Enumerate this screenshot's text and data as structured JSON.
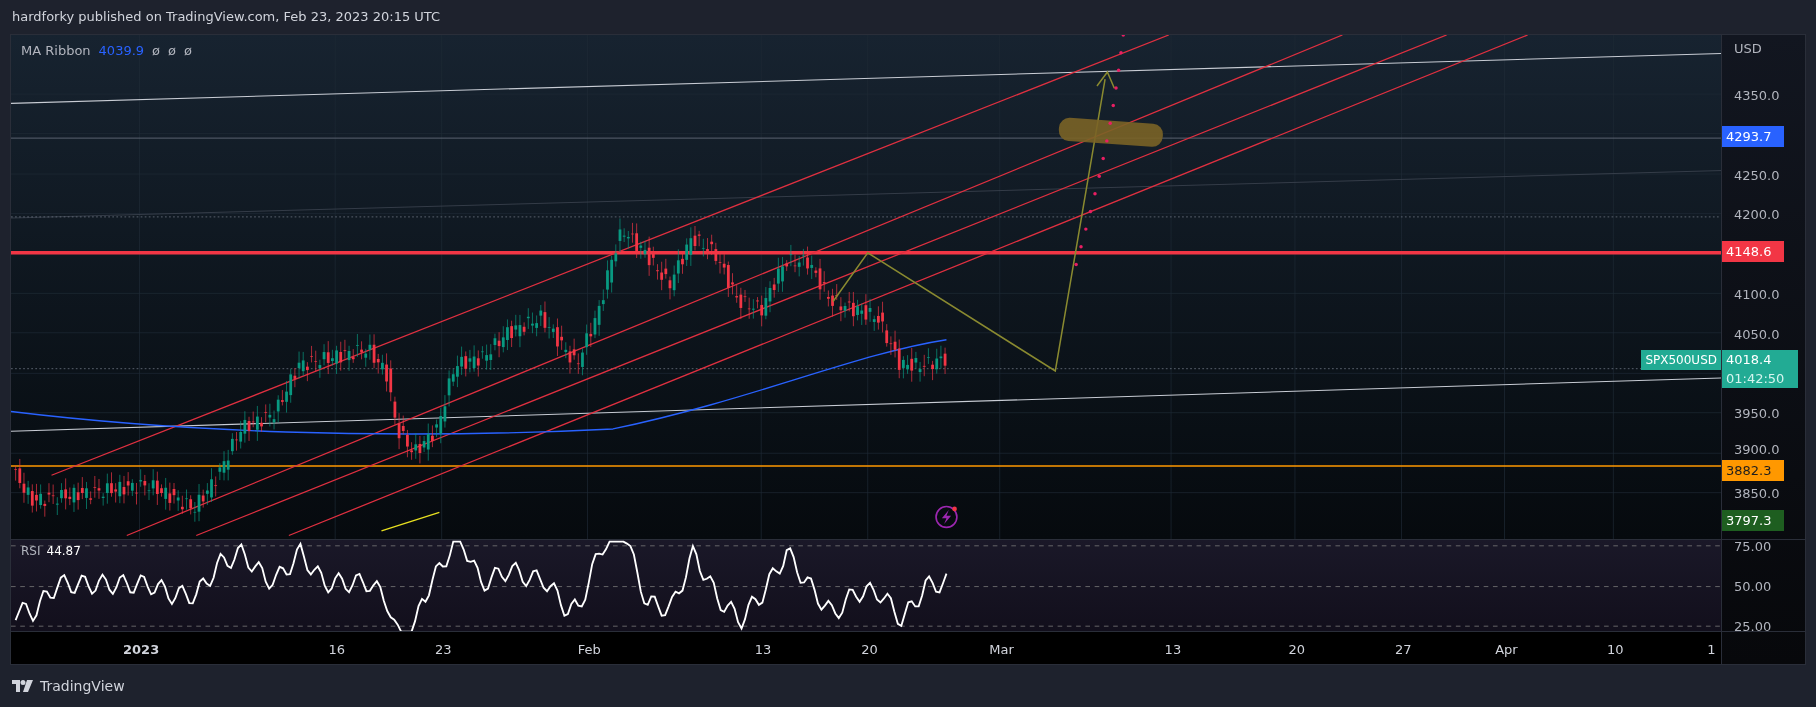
{
  "header": {
    "text": "hardforky published on TradingView.com, Feb 23, 2023 20:15 UTC"
  },
  "legend": {
    "name": "MA Ribbon",
    "value": "4039.9",
    "extras": [
      "ø",
      "ø",
      "ø"
    ]
  },
  "price_axis": {
    "currency": "USD",
    "ticks": [
      "4350.0",
      "4250.0",
      "4200.0",
      "4100.0",
      "4050.0",
      "3950.0",
      "3900.0",
      "3850.0"
    ]
  },
  "price_badges": [
    {
      "label": "4293.7",
      "color": "#2962ff"
    },
    {
      "label": "4148.6",
      "color": "#f23645"
    },
    {
      "label": "4018.4",
      "sublabel": "01:42:50",
      "symbol": "SPX500USD",
      "color": "#22ab94"
    },
    {
      "label": "3882.3",
      "color": "#ff9800"
    },
    {
      "label": "3797.3",
      "color": "#1e5e20"
    }
  ],
  "rsi": {
    "name": "RSI",
    "value": "44.87",
    "ticks": [
      "75.00",
      "50.00",
      "25.00"
    ]
  },
  "time_axis": {
    "labels": [
      {
        "text": "2023",
        "bold": true
      },
      {
        "text": "16",
        "bold": false
      },
      {
        "text": "23",
        "bold": false
      },
      {
        "text": "Feb",
        "bold": false
      },
      {
        "text": "13",
        "bold": false
      },
      {
        "text": "20",
        "bold": false
      },
      {
        "text": "Mar",
        "bold": false
      },
      {
        "text": "13",
        "bold": false
      },
      {
        "text": "20",
        "bold": false
      },
      {
        "text": "27",
        "bold": false
      },
      {
        "text": "Apr",
        "bold": false
      },
      {
        "text": "10",
        "bold": false
      },
      {
        "text": "1",
        "bold": false
      }
    ]
  },
  "footer": {
    "brand": "TradingView"
  }
}
